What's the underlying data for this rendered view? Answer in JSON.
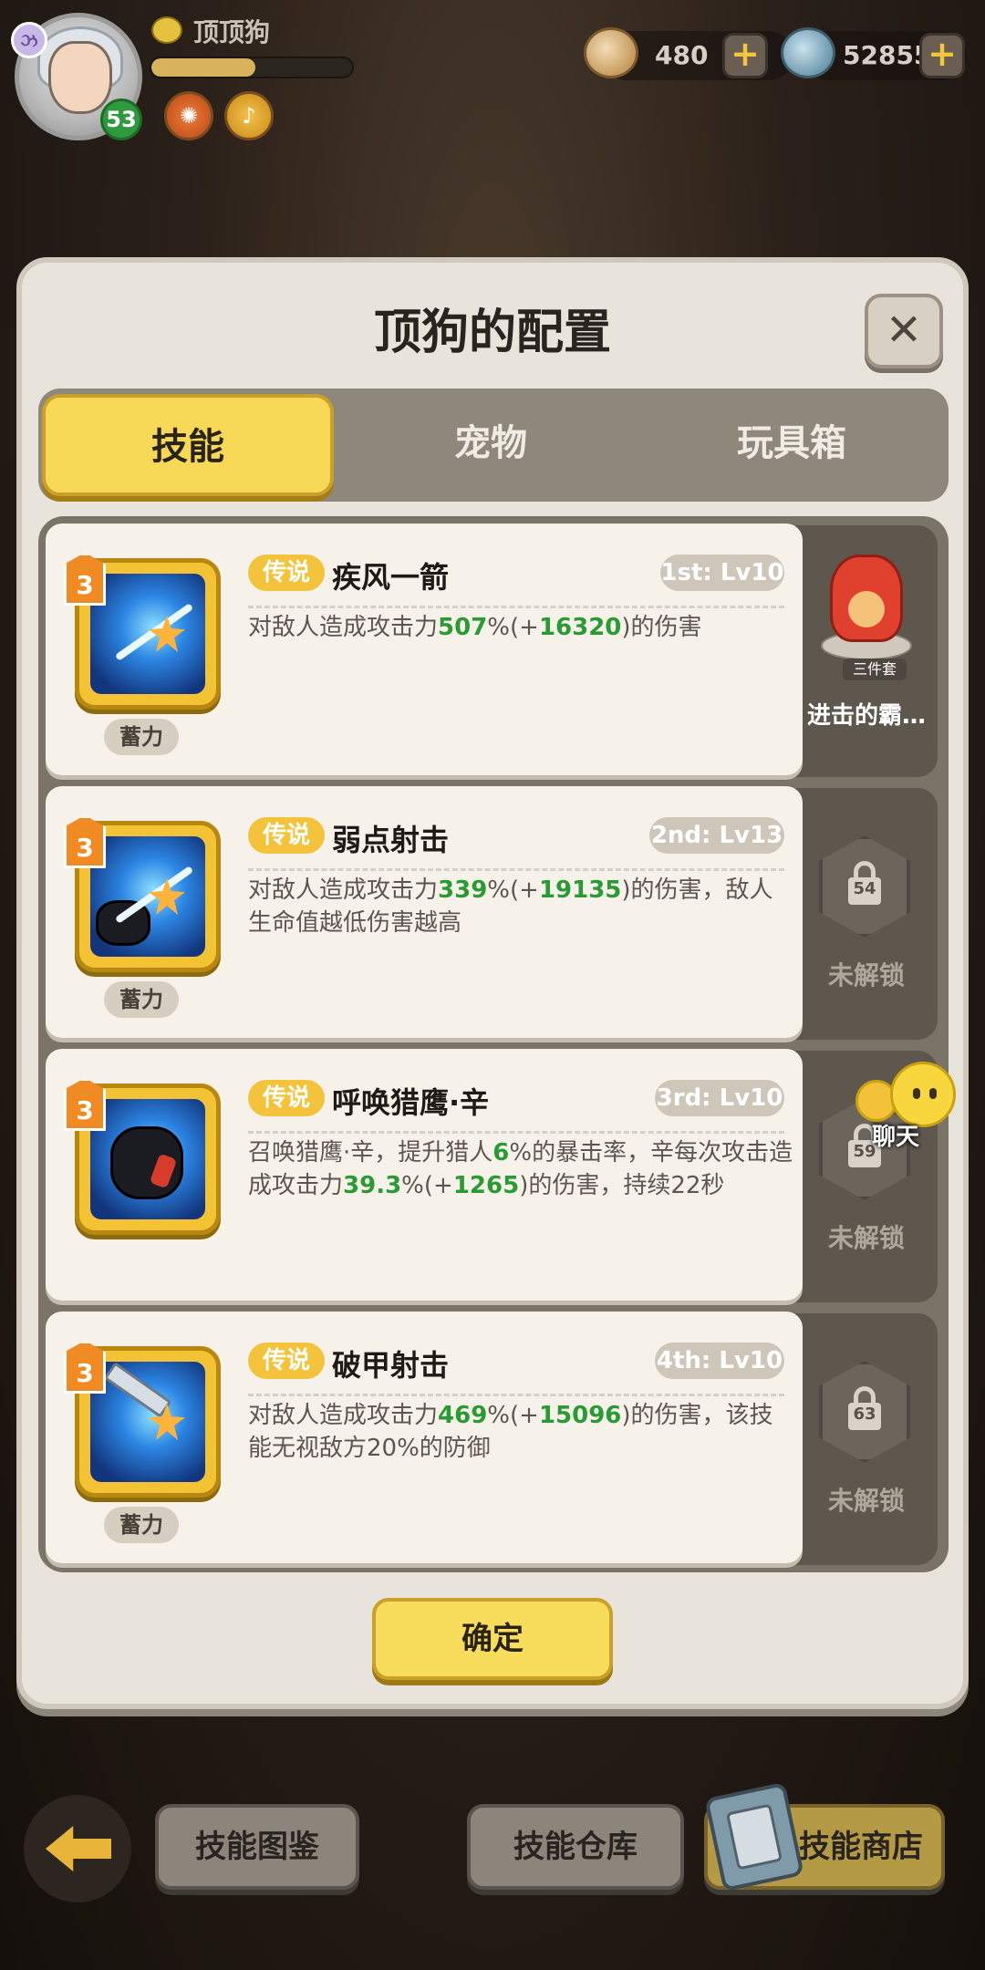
{
  "player": {
    "name": "顶顶狗",
    "level": "53",
    "avatar_badge": "ઝ",
    "xp_percent": 52
  },
  "currency": {
    "shells": "480",
    "gems": "52855",
    "plus_symbol": "+"
  },
  "modal": {
    "title": "顶狗的配置",
    "close_symbol": "✕",
    "tabs": [
      "技能",
      "宠物",
      "玩具箱"
    ],
    "active_tab": 0,
    "confirm_label": "确定"
  },
  "skills": [
    {
      "badge": "3",
      "rarity": "传说",
      "name": "疾风一箭",
      "slot": "1st: Lv10",
      "charge": "蓄力",
      "desc_parts": [
        "对敌人造成攻击力",
        "507",
        "%(+",
        "16320",
        ")的伤害"
      ]
    },
    {
      "badge": "3",
      "rarity": "传说",
      "name": "弱点射击",
      "slot": "2nd: Lv13",
      "charge": "蓄力",
      "desc_parts": [
        "对敌人造成攻击力",
        "339",
        "%(+",
        "19135",
        ")的伤害，敌人生命值越低伤害越高"
      ]
    },
    {
      "badge": "3",
      "rarity": "传说",
      "name": "呼唤猎鹰·辛",
      "slot": "3rd: Lv10",
      "charge": "",
      "desc_parts": [
        "召唤猎鹰·辛，提升猎人",
        "6",
        "%的暴击率，辛每次攻击造成攻击力",
        "39.3",
        "%(+",
        "1265",
        ")的伤害，持续22秒"
      ]
    },
    {
      "badge": "3",
      "rarity": "传说",
      "name": "破甲射击",
      "slot": "4th: Lv10",
      "charge": "蓄力",
      "desc_parts": [
        "对敌人造成攻击力",
        "469",
        "%(+",
        "15096",
        ")的伤害，该技能无视敌方20%的防御"
      ]
    }
  ],
  "side": {
    "outfit_name": "进击的霸…",
    "outfit_set": "三件套",
    "locked_label": "未解锁",
    "lock_levels": [
      "54",
      "59",
      "63"
    ]
  },
  "chat": {
    "label": "聊天"
  },
  "bottom": {
    "atlas": "技能图鉴",
    "warehouse": "技能仓库",
    "shop": "技能商店"
  },
  "colors": {
    "accent_yellow": "#f7d957",
    "highlight_green": "#2a9b34",
    "rarity_gold": "#f3c33b"
  }
}
